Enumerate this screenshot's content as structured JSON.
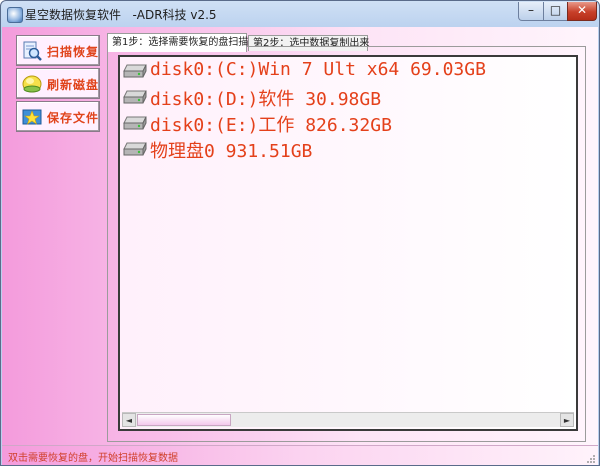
{
  "window": {
    "title": "星空数据恢复软件   -ADR科技 v2.5"
  },
  "titlebar_controls": {
    "minimize": "–",
    "maximize": "□",
    "close": "✕"
  },
  "sidebar": {
    "buttons": [
      {
        "label": "扫描恢复",
        "icon": "scan-icon"
      },
      {
        "label": "刷新磁盘",
        "icon": "refresh-disk-icon"
      },
      {
        "label": "保存文件",
        "icon": "save-file-icon"
      }
    ]
  },
  "tabs": [
    {
      "label": "第1步：选择需要恢复的盘扫描",
      "selected": true
    },
    {
      "label": "第2步：选中数据复制出来",
      "selected": false
    }
  ],
  "disks": [
    {
      "label": "disk0:(C:)Win 7 Ult x64 69.03GB"
    },
    {
      "label": "disk0:(D:)软件 30.98GB"
    },
    {
      "label": "disk0:(E:)工作 826.32GB"
    },
    {
      "label": "物理盘0 931.51GB"
    }
  ],
  "scrollbar": {
    "left_arrow": "◄",
    "right_arrow": "►"
  },
  "status": {
    "text": "双击需要恢复的盘，开始扫描恢复数据"
  },
  "colors": {
    "accent_text": "#e4401a",
    "sidebar_pink": "#f49bdc"
  }
}
